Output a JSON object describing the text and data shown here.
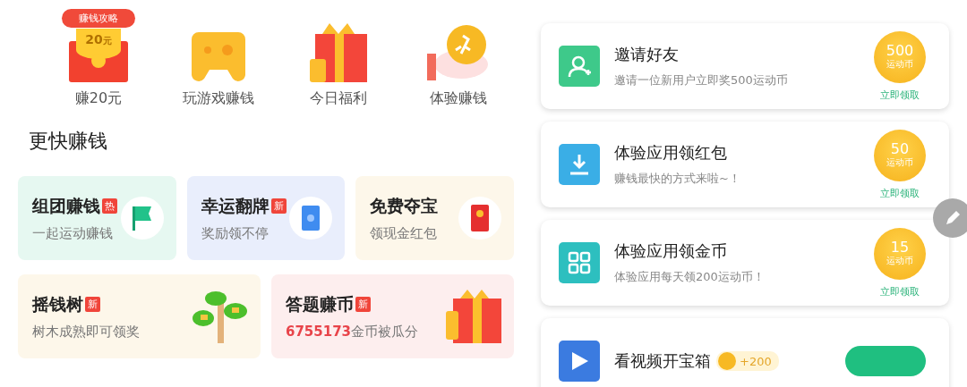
{
  "shortcuts": [
    {
      "kind": "envelope",
      "label": "赚20元",
      "badge": "赚钱攻略",
      "amount": "20",
      "unit": "元"
    },
    {
      "kind": "gamepad",
      "label": "玩游戏赚钱"
    },
    {
      "kind": "gift",
      "label": "今日福利"
    },
    {
      "kind": "coin",
      "label": "体验赚钱"
    }
  ],
  "section_title": "更快赚钱",
  "feature_row_1": [
    {
      "title": "组团赚钱",
      "tag": "热",
      "subtitle": "一起运动赚钱",
      "color": "#e6f8f1"
    },
    {
      "title": "幸运翻牌",
      "tag": "新",
      "subtitle": "奖励领不停",
      "color": "#e9eefc"
    },
    {
      "title": "免费夺宝",
      "subtitle": "领现金红包",
      "color": "#fdf7ea"
    }
  ],
  "feature_row_2": [
    {
      "title": "摇钱树",
      "tag": "新",
      "subtitle": "树木成熟即可领奖",
      "color": "#fdf7ea"
    },
    {
      "title": "答题赚币",
      "tag": "新",
      "highlight": "6755173",
      "subtitle": "金币被瓜分",
      "color": "#fdeeee"
    }
  ],
  "tasks": [
    {
      "kind": "reward",
      "color": "#3ec98a",
      "title": "邀请好友",
      "subtitle": "邀请一位新用户立即奖500运动币",
      "amount": "500",
      "unit": "运动币",
      "action": "立即领取"
    },
    {
      "kind": "reward",
      "color": "#3aaee6",
      "title": "体验应用领红包",
      "subtitle": "赚钱最快的方式来啦~！",
      "amount": "50",
      "unit": "运动币",
      "action": "立即领取"
    },
    {
      "kind": "reward",
      "color": "#2dbfbf",
      "title": "体验应用领金币",
      "subtitle": "体验应用每天领200运动币！",
      "amount": "15",
      "unit": "运动币",
      "action": "立即领取"
    },
    {
      "kind": "video",
      "color": "#3b7be0",
      "title": "看视频开宝箱",
      "bonus": "+200"
    }
  ]
}
